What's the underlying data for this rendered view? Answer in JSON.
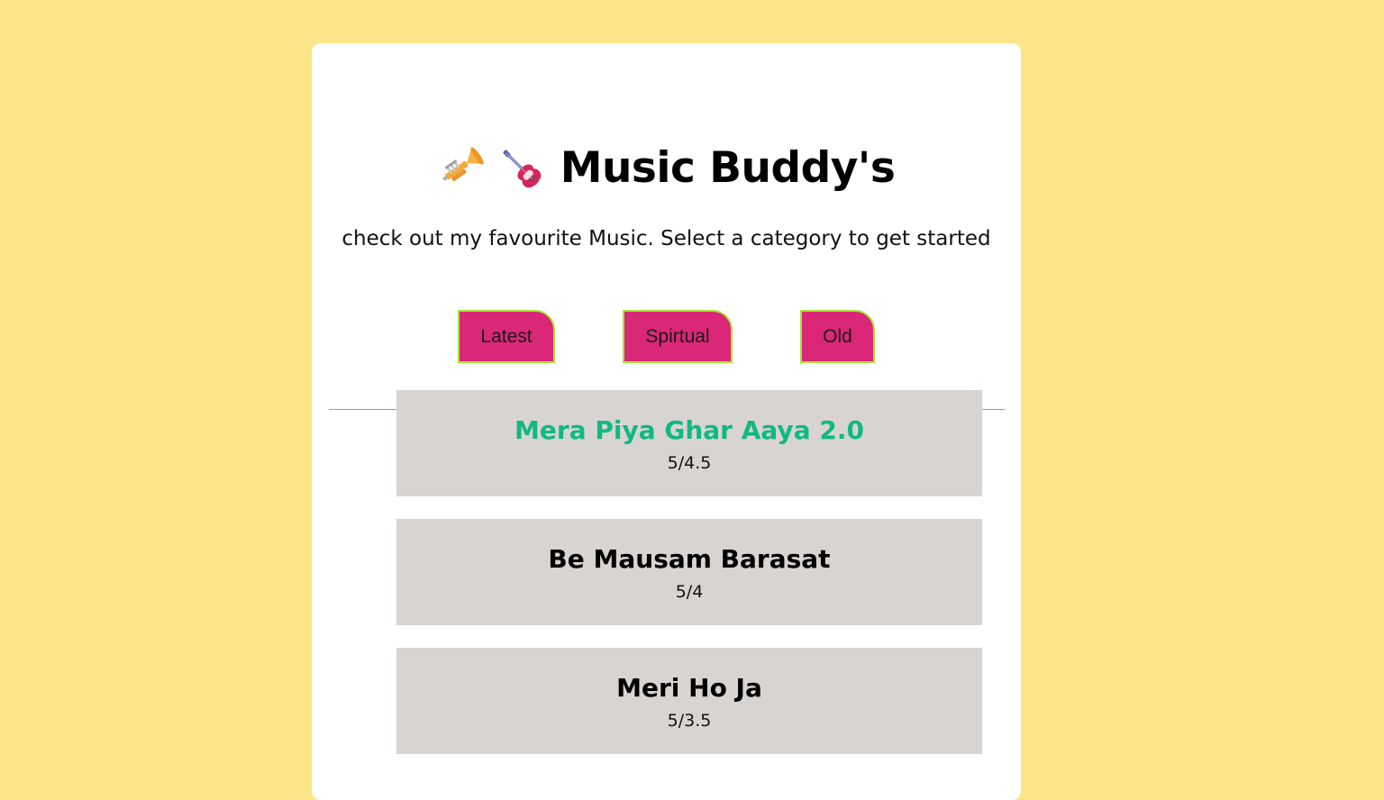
{
  "header": {
    "title": "Music Buddy's",
    "icons": [
      "trumpet-icon",
      "guitar-icon"
    ],
    "subtitle": "check out my favourite Music. Select a category to get started"
  },
  "categories": [
    {
      "label": "Latest"
    },
    {
      "label": "Spirtual"
    },
    {
      "label": "Old"
    }
  ],
  "songs": [
    {
      "title": "Mera Piya Ghar Aaya 2.0",
      "rating": "5/4.5",
      "highlighted": true
    },
    {
      "title": "Be Mausam Barasat",
      "rating": "5/4",
      "highlighted": false
    },
    {
      "title": "Meri Ho Ja",
      "rating": "5/3.5",
      "highlighted": false
    }
  ],
  "colors": {
    "page_background": "#fde68a",
    "card_background": "#ffffff",
    "button_fill": "#db2777",
    "button_border": "#a3e635",
    "song_background": "#d8d4d2",
    "highlight_title": "#10b981"
  }
}
